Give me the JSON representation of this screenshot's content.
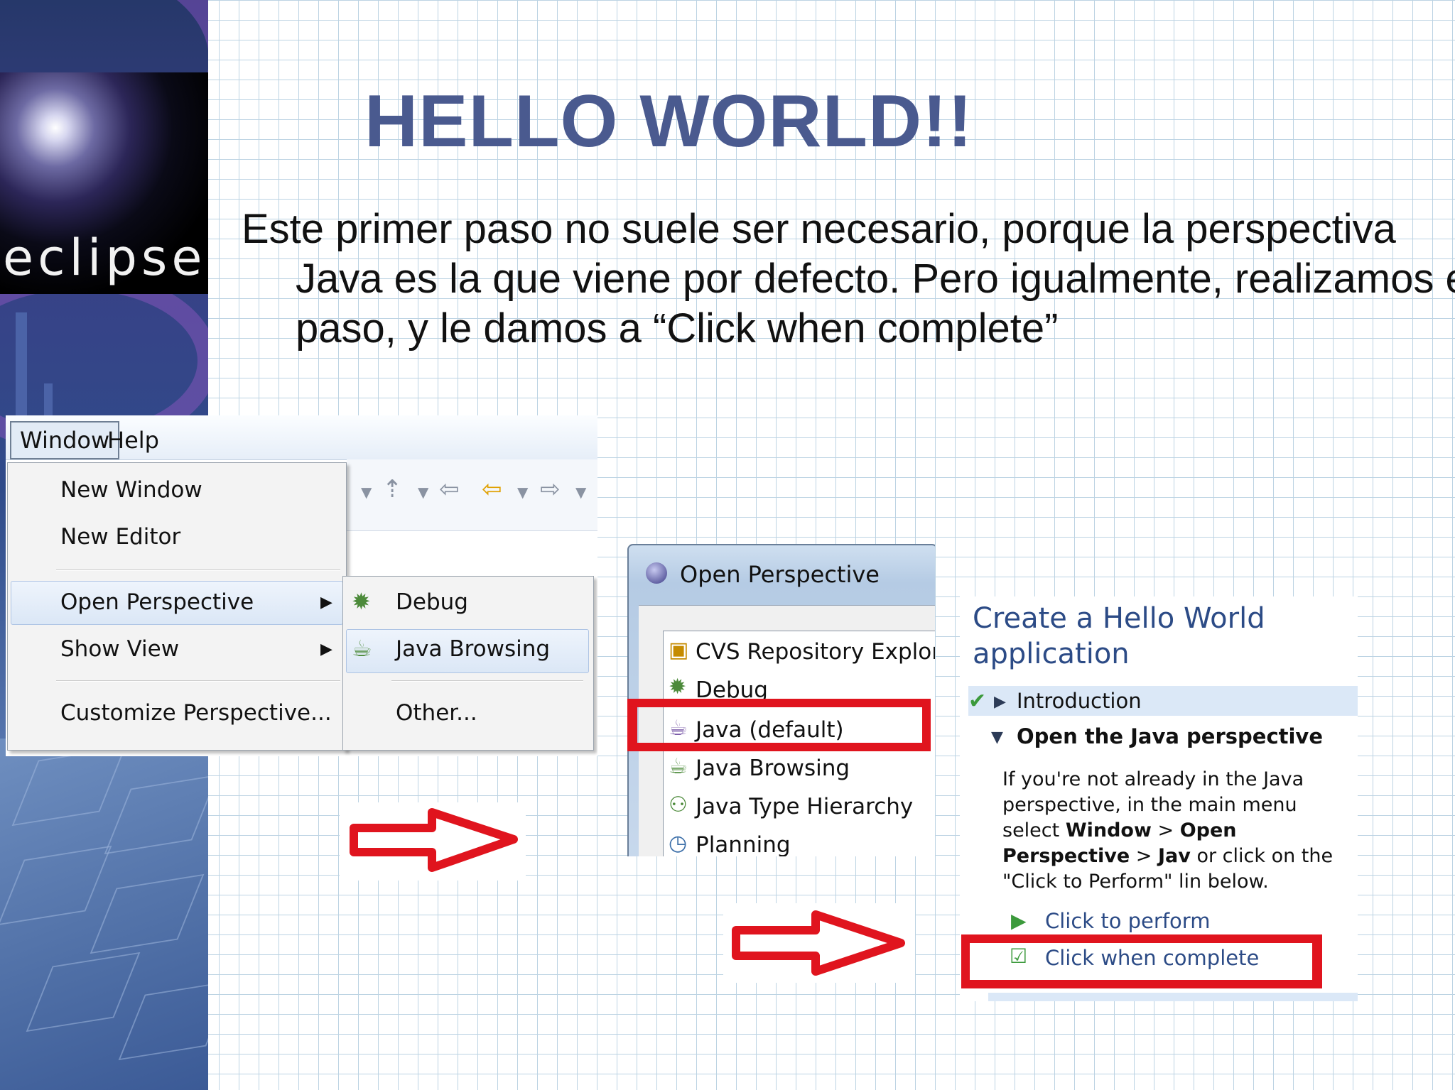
{
  "logo": {
    "text": "eclipse"
  },
  "slide": {
    "title": "HELLO WORLD!!",
    "body": "Este primer paso no suele ser necesario, porque la perspectiva Java es la que viene por defecto. Pero igualmente, realizamos el paso, y le damos a “Click when complete”"
  },
  "menu_shot": {
    "menubar": [
      "Window",
      "Help"
    ],
    "dropdown": [
      "New Window",
      "New Editor",
      "Open Perspective",
      "Show View",
      "Customize Perspective..."
    ],
    "submenu": [
      "Debug",
      "Java Browsing",
      "Other..."
    ]
  },
  "dialog_shot": {
    "title": "Open Perspective",
    "items": [
      "CVS Repository Exploring",
      "Debug",
      "Java (default)",
      "Java Browsing",
      "Java Type Hierarchy",
      "Planning"
    ]
  },
  "cheatsheet_shot": {
    "title": "Create a Hello World application",
    "steps": [
      "Introduction",
      "Open the Java perspective"
    ],
    "description_parts": [
      "If you're not already in the Java perspective, in the main menu select ",
      "Window",
      " > ",
      "Open Perspective",
      " > ",
      "Jav",
      " or click on the \"Click to Perform\" lin below."
    ],
    "links": [
      "Click to perform",
      "Click when complete"
    ]
  },
  "colors": {
    "title": "#4a5a8f",
    "highlight_red": "#e0141e",
    "link_blue": "#2c4b86"
  }
}
